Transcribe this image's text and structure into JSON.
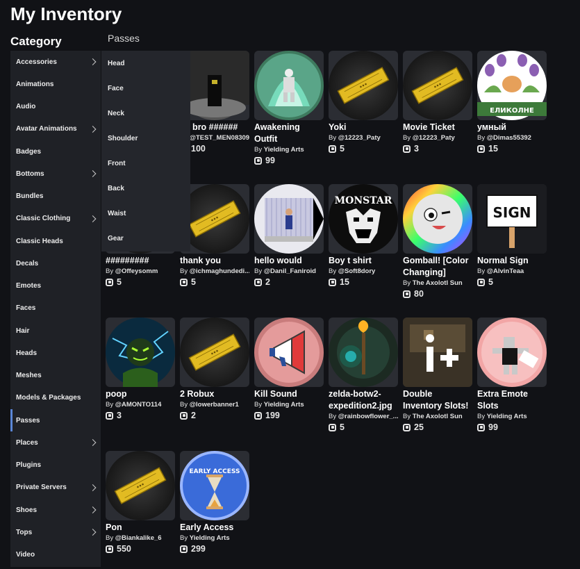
{
  "header": {
    "title": "My Inventory",
    "category_label": "Category",
    "section_label": "Passes"
  },
  "sidebar": {
    "items": [
      {
        "label": "Accessories",
        "chevron": true
      },
      {
        "label": "Animations",
        "chevron": false
      },
      {
        "label": "Audio",
        "chevron": false
      },
      {
        "label": "Avatar Animations",
        "chevron": true
      },
      {
        "label": "Badges",
        "chevron": false
      },
      {
        "label": "Bottoms",
        "chevron": true
      },
      {
        "label": "Bundles",
        "chevron": false
      },
      {
        "label": "Classic Clothing",
        "chevron": true
      },
      {
        "label": "Classic Heads",
        "chevron": false
      },
      {
        "label": "Decals",
        "chevron": false
      },
      {
        "label": "Emotes",
        "chevron": false
      },
      {
        "label": "Faces",
        "chevron": false
      },
      {
        "label": "Hair",
        "chevron": false
      },
      {
        "label": "Heads",
        "chevron": false
      },
      {
        "label": "Meshes",
        "chevron": false
      },
      {
        "label": "Models & Packages",
        "chevron": false
      },
      {
        "label": "Passes",
        "chevron": false,
        "active": true
      },
      {
        "label": "Places",
        "chevron": true
      },
      {
        "label": "Plugins",
        "chevron": false
      },
      {
        "label": "Private Servers",
        "chevron": true
      },
      {
        "label": "Shoes",
        "chevron": true
      },
      {
        "label": "Tops",
        "chevron": true
      },
      {
        "label": "Video",
        "chevron": false
      }
    ]
  },
  "dropdown": {
    "items": [
      "Head",
      "Face",
      "Neck",
      "Shoulder",
      "Front",
      "Back",
      "Waist",
      "Gear"
    ]
  },
  "items": [
    {
      "name": "yo bro ######",
      "creator": "@TEST_MEN08309",
      "price": "100",
      "thumb": "dark-room"
    },
    {
      "name": "Awakening Outfit",
      "creator": "Yielding Arts",
      "price": "99",
      "thumb": "green-aura"
    },
    {
      "name": "Yoki",
      "creator": "@12223_Paty",
      "price": "5",
      "thumb": "ticket"
    },
    {
      "name": "Movie Ticket",
      "creator": "@12223_Paty",
      "price": "3",
      "thumb": "ticket"
    },
    {
      "name": "умный",
      "creator": "@Dimas55392",
      "price": "15",
      "thumb": "flowers"
    },
    {
      "name": "#########",
      "creator": "@Offeysomm",
      "price": "5",
      "thumb": "blank"
    },
    {
      "name": "thank you",
      "creator": "@ichmaghundedi...",
      "price": "5",
      "thumb": "ticket"
    },
    {
      "name": "hello would",
      "creator": "@Danil_Faniroid",
      "price": "2",
      "thumb": "cage"
    },
    {
      "name": "Boy t shirt",
      "creator": "@Soft8dory",
      "price": "15",
      "thumb": "monster"
    },
    {
      "name": "Gomball! [Color Changing]",
      "creator": "The Axolotl Sun",
      "price": "80",
      "thumb": "gumball"
    },
    {
      "name": "Normal Sign",
      "creator": "@AlvinTeaa",
      "price": "5",
      "thumb": "sign"
    },
    {
      "name": "poop",
      "creator": "@AMONTO114",
      "price": "3",
      "thumb": "lightning"
    },
    {
      "name": "2 Robux",
      "creator": "@lowerbanner1",
      "price": "2",
      "thumb": "ticket"
    },
    {
      "name": "Kill Sound",
      "creator": "Yielding Arts",
      "price": "199",
      "thumb": "megaphone"
    },
    {
      "name": "zelda-botw2-expedition2.jpg",
      "creator": "@rainbowflower_...",
      "price": "5",
      "thumb": "torch"
    },
    {
      "name": "Double Inventory Slots!",
      "creator": "The Axolotl Sun",
      "price": "25",
      "thumb": "iplus"
    },
    {
      "name": "Extra Emote Slots",
      "creator": "Yielding Arts",
      "price": "99",
      "thumb": "emote"
    },
    {
      "name": "Pon",
      "creator": "@Biankalike_6",
      "price": "550",
      "thumb": "ticket"
    },
    {
      "name": "Early Access",
      "creator": "Yielding Arts",
      "price": "299",
      "thumb": "hourglass"
    }
  ],
  "labels": {
    "by": "By",
    "sign_text": "SIGN",
    "flowers_text": "ЕЛИКОЛНЕ",
    "early_access_text": "EARLY ACCESS",
    "monster_text": "MONSTAR"
  }
}
